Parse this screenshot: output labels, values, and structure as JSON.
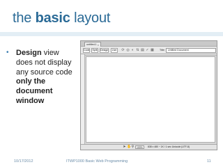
{
  "slide": {
    "title_pre": "the",
    "title_bold": "basic",
    "title_post": "layout",
    "bullet": {
      "glyph": "•",
      "part1_bold": "Design",
      "part2": " view does not display any source code ",
      "part3_bold": "only the document window"
    },
    "footer": {
      "date": "10/17/2012",
      "course": "ITWP1000 Basic Web Programming",
      "page": "11"
    }
  },
  "app": {
    "doc_tab": "untitled-1",
    "close_glyph": "×",
    "toolbar": {
      "buttons": [
        "Code",
        "Split",
        "Design",
        "Live"
      ],
      "title_label": "Title:",
      "title_value": "Untitled Document"
    },
    "status": {
      "zoom": "100%",
      "info": "838 x 480 ~ 1K / 1 sec Unicode (UTF-8)"
    }
  }
}
